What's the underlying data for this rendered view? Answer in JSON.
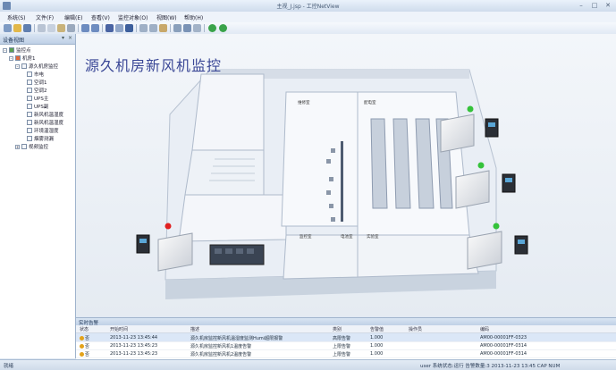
{
  "window": {
    "title": "主视_J.jsp - 工控NetView",
    "icon": "app-icon",
    "controls": [
      "minimize-icon",
      "maximize-icon",
      "close-icon"
    ]
  },
  "menu": {
    "items": [
      {
        "label": "系统(S)"
      },
      {
        "label": "文件(F)"
      },
      {
        "label": "编辑(E)"
      },
      {
        "label": "查看(V)"
      },
      {
        "label": "监控对象(O)"
      },
      {
        "label": "视图(W)"
      },
      {
        "label": "帮助(H)"
      }
    ]
  },
  "left_panel": {
    "title": "设备视图",
    "tree": [
      {
        "label": "监控点",
        "icon": "root-node-icon",
        "level": 0
      },
      {
        "label": "机房1",
        "icon": "home-icon",
        "level": 1
      },
      {
        "label": "源久机房监控",
        "icon": "folder-icon",
        "level": 2
      },
      {
        "label": "市电",
        "icon": "device-icon",
        "level": 3
      },
      {
        "label": "空调1",
        "icon": "device-icon",
        "level": 3
      },
      {
        "label": "空调2",
        "icon": "device-icon",
        "level": 3
      },
      {
        "label": "UPS主",
        "icon": "device-icon",
        "level": 3
      },
      {
        "label": "UPS副",
        "icon": "device-icon",
        "level": 3
      },
      {
        "label": "新风机温湿度",
        "icon": "device-icon",
        "level": 3
      },
      {
        "label": "新风机温湿度",
        "icon": "device-icon",
        "level": 3
      },
      {
        "label": "环境温湿度",
        "icon": "device-icon",
        "level": 3
      },
      {
        "label": "烟雾测漏",
        "icon": "device-icon",
        "level": 3
      },
      {
        "label": "视频监控",
        "icon": "camera-icon",
        "level": 2
      }
    ]
  },
  "main_view": {
    "heading": "源久机房新风机监控",
    "room_labels": [
      "维修室",
      "配电室",
      "监控室",
      "电池室",
      "实验室"
    ],
    "units": [
      {
        "status": "ok",
        "status_color": "#34c23a"
      },
      {
        "status": "ok",
        "status_color": "#34c23a"
      },
      {
        "status": "ok",
        "status_color": "#34c23a"
      },
      {
        "status": "alarm",
        "status_color": "#e02020"
      }
    ]
  },
  "alarm_panel": {
    "title": "实时告警",
    "columns": [
      "状态",
      "开始时间",
      "描述",
      "类别",
      "告警值",
      "操作员",
      "编码"
    ],
    "rows": [
      {
        "state": "否",
        "time": "2013-11-23 13:45:44",
        "desc": "源久机房监控新风机温湿度监测Humi超限报警",
        "category": "高限告警",
        "value": "1.000",
        "operator": "",
        "code": "AM00-00001FF-0323"
      },
      {
        "state": "否",
        "time": "2013-11-23 13:45:23",
        "desc": "源久机房监控新风机1温度告警",
        "category": "上限告警",
        "value": "1.000",
        "operator": "",
        "code": "AM00-00001FF-0314"
      },
      {
        "state": "否",
        "time": "2013-11-23 13:45:23",
        "desc": "源久机房监控新风机2温度告警",
        "category": "上限告警",
        "value": "1.000",
        "operator": "",
        "code": "AM00-00001FF-0314"
      }
    ]
  },
  "statusbar": {
    "left": "就绪",
    "right": "user  系统状态:运行  告警数量:3  2013-11-23 13:45 CAP NUM"
  },
  "colors": {
    "accent": "#3a4796",
    "ok": "#34c23a",
    "alarm": "#e02020",
    "warn": "#e3a21a"
  }
}
